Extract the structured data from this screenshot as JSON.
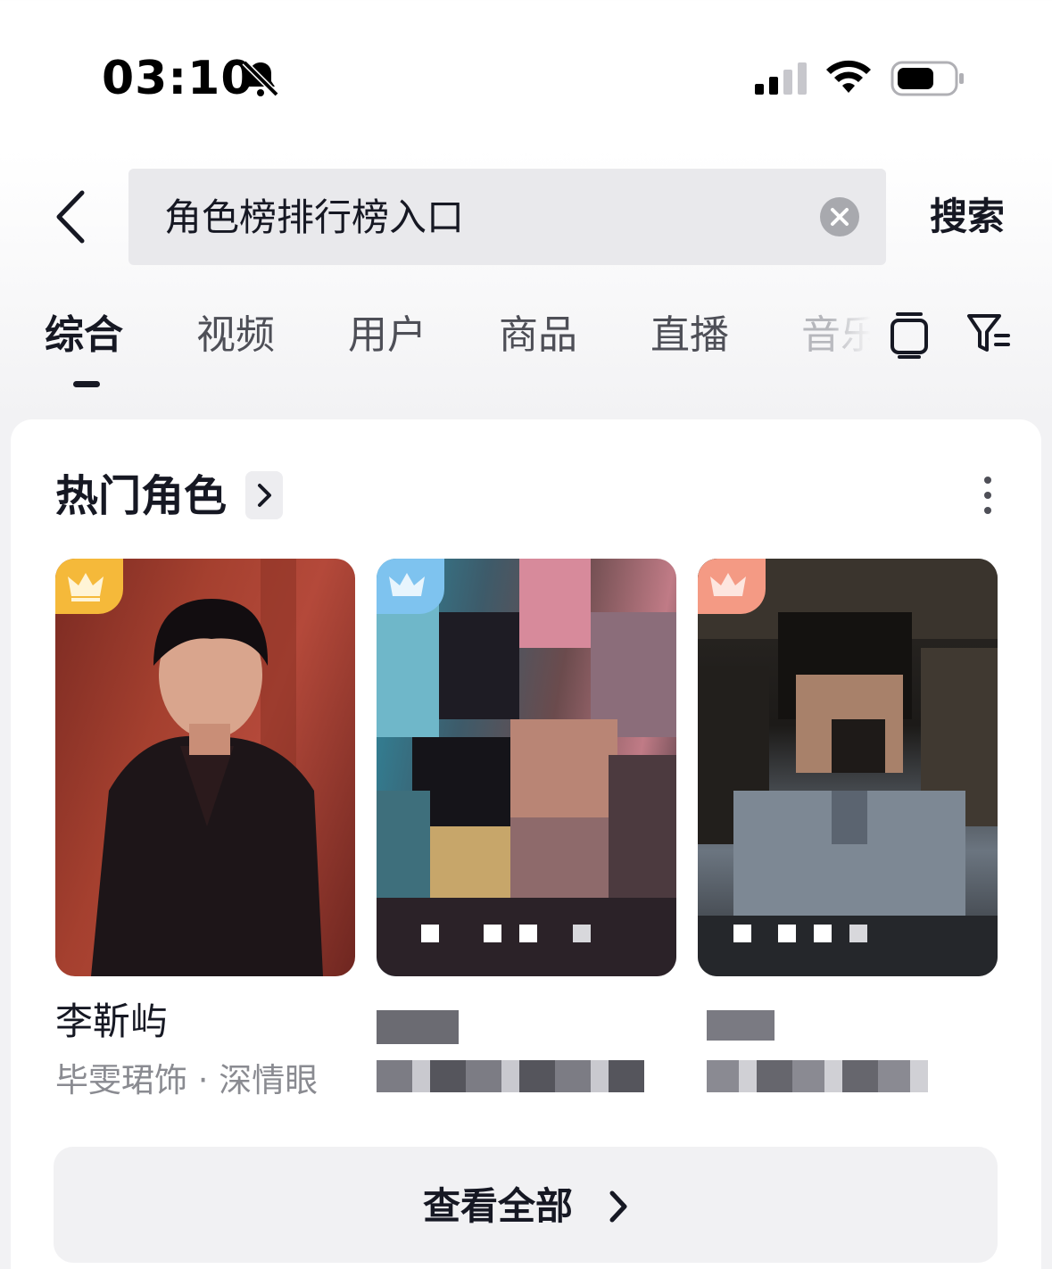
{
  "status_bar": {
    "time": "03:10",
    "icons": [
      "bell-off-icon",
      "signal-icon",
      "wifi-icon",
      "battery-icon"
    ]
  },
  "search": {
    "query": "角色榜排行榜入口",
    "submit_label": "搜索"
  },
  "tabs": [
    {
      "label": "综合",
      "active": true
    },
    {
      "label": "视频",
      "active": false
    },
    {
      "label": "用户",
      "active": false
    },
    {
      "label": "商品",
      "active": false
    },
    {
      "label": "直播",
      "active": false
    },
    {
      "label": "音乐",
      "active": false
    }
  ],
  "section": {
    "title": "热门角色",
    "characters": [
      {
        "name": "李靳屿",
        "subtitle": "毕雯珺饰 · 深情眼",
        "badge": "gold-crown-icon"
      },
      {
        "name": "",
        "subtitle": "",
        "badge": "silver-crown-icon"
      },
      {
        "name": "",
        "subtitle": "",
        "badge": "bronze-crown-icon"
      }
    ],
    "view_all_label": "查看全部"
  },
  "colors": {
    "text_primary": "#161823",
    "text_secondary": "#8a8b91",
    "gold_badge": "#f5b93a",
    "silver_badge": "#7ec3ef",
    "bronze_badge": "#f49a84"
  }
}
